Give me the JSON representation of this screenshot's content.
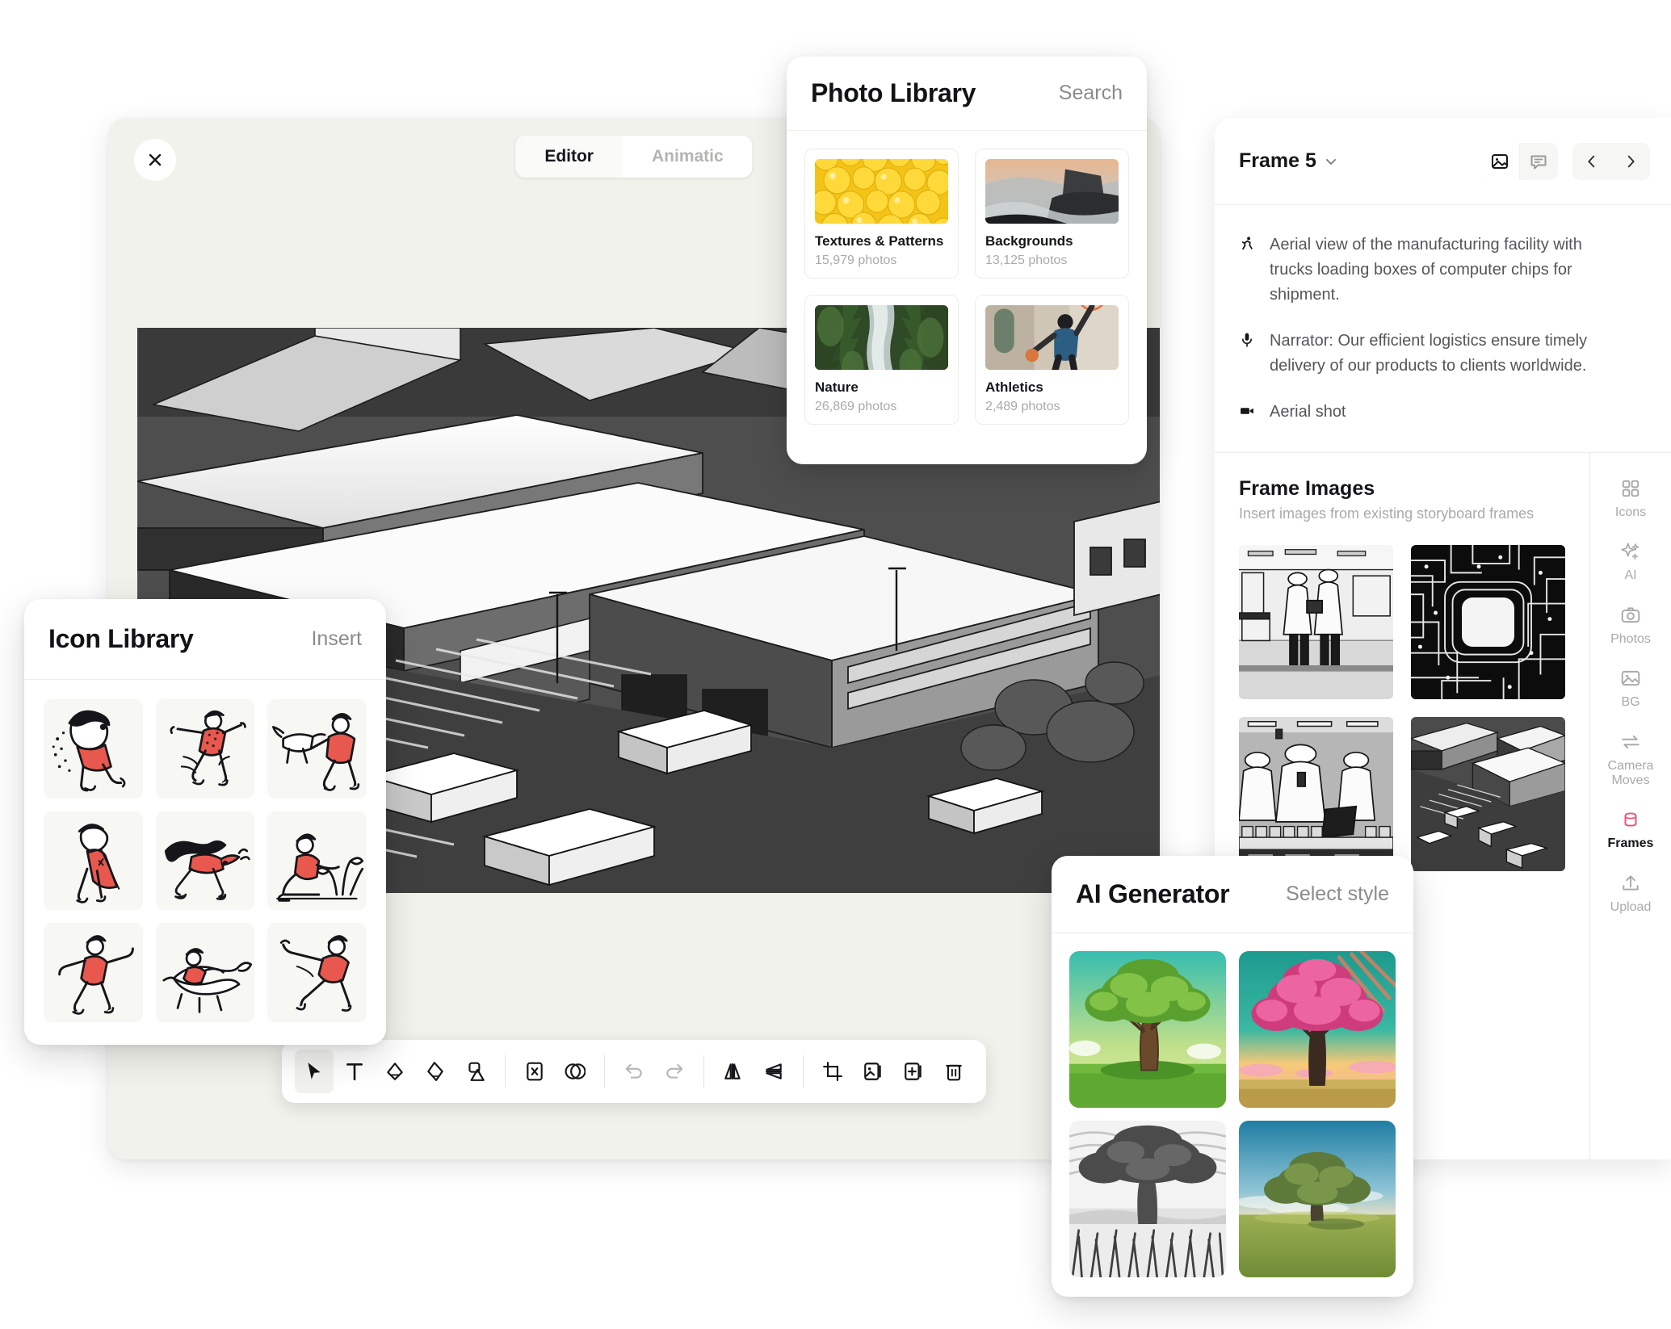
{
  "editor": {
    "close_label": "✕",
    "tabs": [
      {
        "label": "Editor",
        "active": true
      },
      {
        "label": "Animatic",
        "active": false
      }
    ],
    "collapse_icon": "collapse-right-icon",
    "toolbar": [
      {
        "name": "select-tool",
        "icon": "cursor-arrow-icon",
        "active": true,
        "disabled": false
      },
      {
        "name": "text-tool",
        "icon": "text-t-icon",
        "active": false,
        "disabled": false
      },
      {
        "name": "eraser-tool",
        "icon": "eraser-icon",
        "active": false,
        "disabled": false
      },
      {
        "name": "pen-tool",
        "icon": "pen-icon",
        "active": false,
        "disabled": false
      },
      {
        "name": "shapes-tool",
        "icon": "shapes-icon",
        "active": false,
        "disabled": false
      },
      {
        "name": "divider-1",
        "icon": "divider",
        "active": false,
        "disabled": false
      },
      {
        "name": "mask-tool",
        "icon": "x-box-icon",
        "active": false,
        "disabled": false
      },
      {
        "name": "blend-tool",
        "icon": "venn-circles-icon",
        "active": false,
        "disabled": false
      },
      {
        "name": "divider-2",
        "icon": "divider",
        "active": false,
        "disabled": false
      },
      {
        "name": "undo-button",
        "icon": "undo-arrow-icon",
        "active": false,
        "disabled": true
      },
      {
        "name": "redo-button",
        "icon": "redo-arrow-icon",
        "active": false,
        "disabled": true
      },
      {
        "name": "divider-3",
        "icon": "divider",
        "active": false,
        "disabled": false
      },
      {
        "name": "flip-horizontal-button",
        "icon": "flip-horizontal-icon",
        "active": false,
        "disabled": false
      },
      {
        "name": "flip-vertical-button",
        "icon": "flip-vertical-icon",
        "active": false,
        "disabled": false
      },
      {
        "name": "divider-4",
        "icon": "divider",
        "active": false,
        "disabled": false
      },
      {
        "name": "crop-tool",
        "icon": "crop-icon",
        "active": false,
        "disabled": false
      },
      {
        "name": "replace-image-button",
        "icon": "image-swap-icon",
        "active": false,
        "disabled": false
      },
      {
        "name": "add-image-button",
        "icon": "image-plus-icon",
        "active": false,
        "disabled": false
      },
      {
        "name": "delete-button",
        "icon": "trash-icon",
        "active": false,
        "disabled": false
      }
    ]
  },
  "frame_panel": {
    "title": "Frame 5",
    "dropdown_icon": "chevron-down-icon",
    "view_toggle": [
      {
        "name": "image-view-button",
        "icon": "image-icon",
        "active": true
      },
      {
        "name": "script-view-button",
        "icon": "comment-icon",
        "active": false
      }
    ],
    "nav": [
      {
        "name": "previous-frame-button",
        "icon": "chevron-left-icon",
        "label": "‹"
      },
      {
        "name": "next-frame-button",
        "icon": "chevron-right-icon",
        "label": "›"
      }
    ],
    "script": [
      {
        "icon": "action-runner-icon",
        "text": "Aerial view of the manufacturing facility with trucks loading boxes of computer chips for shipment."
      },
      {
        "icon": "microphone-icon",
        "text": "Narrator: Our efficient logistics ensure timely delivery of our products to clients worldwide."
      },
      {
        "icon": "video-camera-icon",
        "text": "Aerial shot"
      }
    ],
    "frame_images": {
      "title": "Frame Images",
      "subtitle": "Insert images from existing storyboard frames",
      "thumbnails": [
        {
          "name": "frame-thumb-lab-technicians"
        },
        {
          "name": "frame-thumb-circuit-board"
        },
        {
          "name": "frame-thumb-assembly-line"
        },
        {
          "name": "frame-thumb-aerial-facility"
        }
      ]
    },
    "rail": [
      {
        "label": "Icons",
        "icon": "grid-squares-icon",
        "active": false
      },
      {
        "label": "AI",
        "icon": "sparkles-icon",
        "active": false
      },
      {
        "label": "Photos",
        "icon": "camera-icon",
        "active": false
      },
      {
        "label": "BG",
        "icon": "picture-icon",
        "active": false
      },
      {
        "label": "Camera\nMoves",
        "icon": "swap-arrows-icon",
        "active": false
      },
      {
        "label": "Frames",
        "icon": "frames-stack-icon",
        "active": true
      },
      {
        "label": "Upload",
        "icon": "upload-arrow-icon",
        "active": false
      }
    ]
  },
  "photo_library": {
    "title": "Photo Library",
    "action_label": "Search",
    "items": [
      {
        "name": "Textures & Patterns",
        "count": "15,979 photos",
        "thumb": "yellow-spheres"
      },
      {
        "name": "Backgrounds",
        "count": "13,125 photos",
        "thumb": "cliff-fog"
      },
      {
        "name": "Nature",
        "count": "26,869 photos",
        "thumb": "forest-river"
      },
      {
        "name": "Athletics",
        "count": "2,489 photos",
        "thumb": "basketball-dunk"
      }
    ]
  },
  "icon_library": {
    "title": "Icon Library",
    "action_label": "Insert",
    "items": [
      {
        "name": "icon-running-person-1"
      },
      {
        "name": "icon-running-person-2"
      },
      {
        "name": "icon-person-with-dog"
      },
      {
        "name": "icon-person-with-cape"
      },
      {
        "name": "icon-long-hair-runner"
      },
      {
        "name": "icon-seated-person-plants"
      },
      {
        "name": "icon-dancing-person"
      },
      {
        "name": "icon-person-riding-animal"
      },
      {
        "name": "icon-leaping-runner"
      }
    ]
  },
  "ai_generator": {
    "title": "AI Generator",
    "action_label": "Select style",
    "styles": [
      {
        "name": "style-illustrated-green-tree"
      },
      {
        "name": "style-vibrant-pink-tree"
      },
      {
        "name": "style-monochrome-engraving-tree"
      },
      {
        "name": "style-photoreal-tree"
      }
    ]
  },
  "colors": {
    "accent": "#e8537a",
    "editor_bg": "#f2f2ec",
    "panel_bg": "#ffffff",
    "text_primary": "#15161a",
    "text_muted": "#a9aaa8"
  }
}
